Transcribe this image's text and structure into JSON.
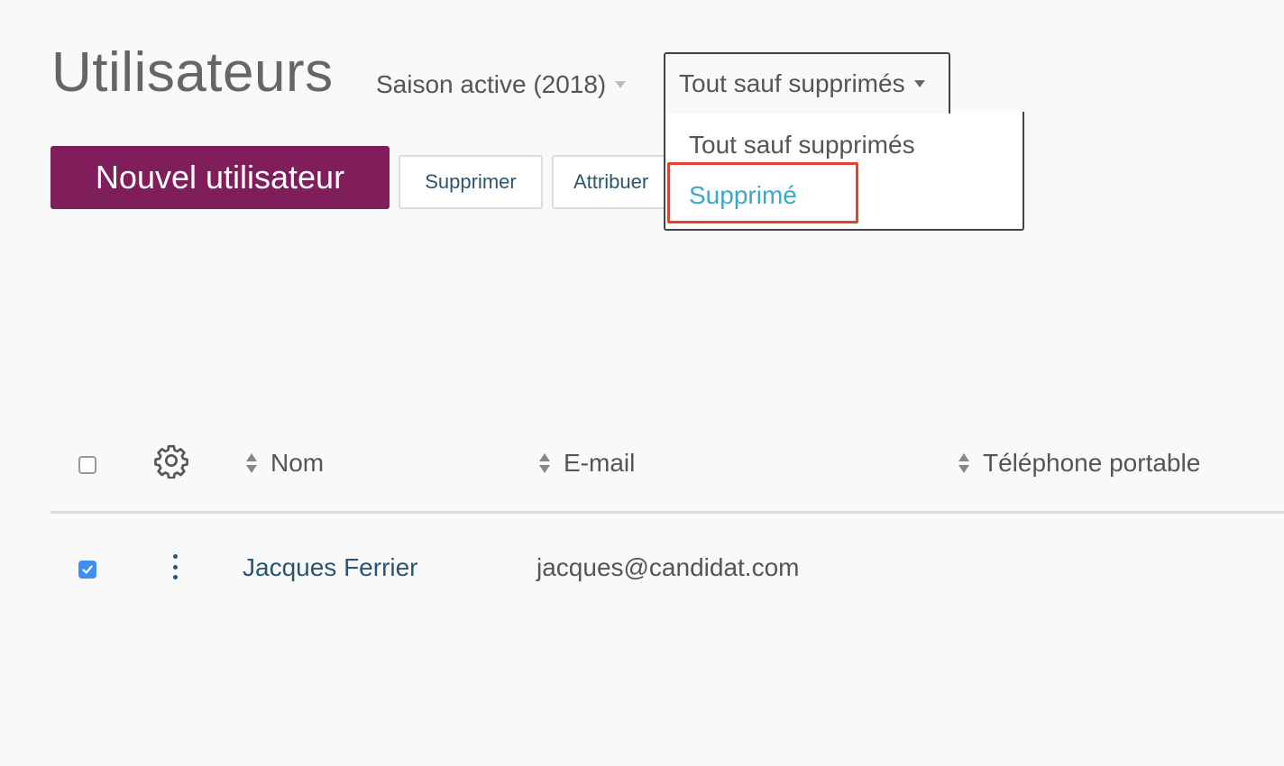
{
  "header": {
    "title": "Utilisateurs",
    "season_selector": "Saison active (2018)",
    "filter": {
      "selected": "Tout sauf supprimés",
      "options": [
        "Tout sauf supprimés",
        "Supprimé"
      ],
      "highlighted_option": "Supprimé"
    }
  },
  "toolbar": {
    "new_user_label": "Nouvel utilisateur",
    "delete_label": "Supprimer",
    "assign_label": "Attribuer"
  },
  "table": {
    "columns": [
      "Nom",
      "E-mail",
      "Téléphone portable"
    ],
    "rows": [
      {
        "checked": true,
        "name": "Jacques Ferrier",
        "email": "jacques@candidat.com",
        "mobile": ""
      }
    ]
  },
  "icons": {
    "settings": "gear-icon",
    "sort": "sort-icon",
    "row_actions": "more-vertical-icon",
    "check": "check-icon"
  },
  "colors": {
    "primary": "#801e5b",
    "link": "#2d5570",
    "menu_active": "#3ea7c9",
    "highlight_border": "#e0432f",
    "checkbox_checked": "#3e8ef7"
  }
}
